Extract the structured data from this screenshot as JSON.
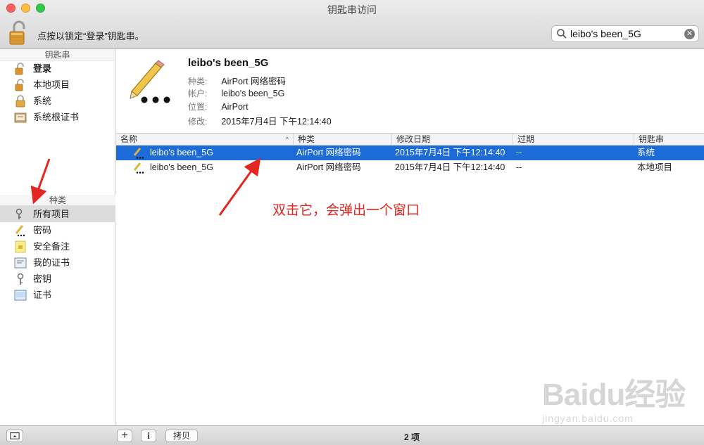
{
  "window": {
    "title": "钥匙串访问",
    "lock_text": "点按以锁定“登录”钥匙串。"
  },
  "search": {
    "value": "leibo's been_5G"
  },
  "sidebar": {
    "keychains_header": "钥匙串",
    "keychains": [
      {
        "label": "登录",
        "icon": "unlocked-padlock-icon"
      },
      {
        "label": "本地项目",
        "icon": "unlocked-padlock-icon"
      },
      {
        "label": "系统",
        "icon": "locked-padlock-icon"
      },
      {
        "label": "系统根证书",
        "icon": "certificate-cabinet-icon"
      }
    ],
    "categories_header": "种类",
    "categories": [
      {
        "label": "所有项目",
        "icon": "all-items-icon"
      },
      {
        "label": "密码",
        "icon": "password-pencil-icon"
      },
      {
        "label": "安全备注",
        "icon": "secure-note-icon"
      },
      {
        "label": "我的证书",
        "icon": "my-certificate-icon"
      },
      {
        "label": "密钥",
        "icon": "key-icon"
      },
      {
        "label": "证书",
        "icon": "certificate-icon"
      }
    ]
  },
  "detail": {
    "name": "leibo's been_5G",
    "kind_label": "种类:",
    "kind_value": "AirPort 网络密码",
    "account_label": "帐户:",
    "account_value": "leibo's been_5G",
    "where_label": "位置:",
    "where_value": "AirPort",
    "modified_label": "修改:",
    "modified_value": "2015年7月4日 下午12:14:40"
  },
  "table": {
    "columns": [
      "名称",
      "种类",
      "修改日期",
      "过期",
      "钥匙串"
    ],
    "sort_indicator": "^",
    "rows": [
      {
        "name": "leibo's been_5G",
        "kind": "AirPort 网络密码",
        "modified": "2015年7月4日 下午12:14:40",
        "expires": "--",
        "keychain": "系统",
        "selected": true
      },
      {
        "name": "leibo's been_5G",
        "kind": "AirPort 网络密码",
        "modified": "2015年7月4日 下午12:14:40",
        "expires": "--",
        "keychain": "本地项目",
        "selected": false
      }
    ]
  },
  "annotation": {
    "text": "双击它，会弹出一个窗口",
    "color": "#e3261f"
  },
  "bottombar": {
    "add_label": "+",
    "info_label": "i",
    "copy_label": "拷贝",
    "status": "2 项"
  },
  "watermark": {
    "logo": "Baidu经验",
    "url": "jingyan.baidu.com"
  },
  "colors": {
    "selection": "#1c6bd9",
    "accent_red": "#e3261f"
  }
}
